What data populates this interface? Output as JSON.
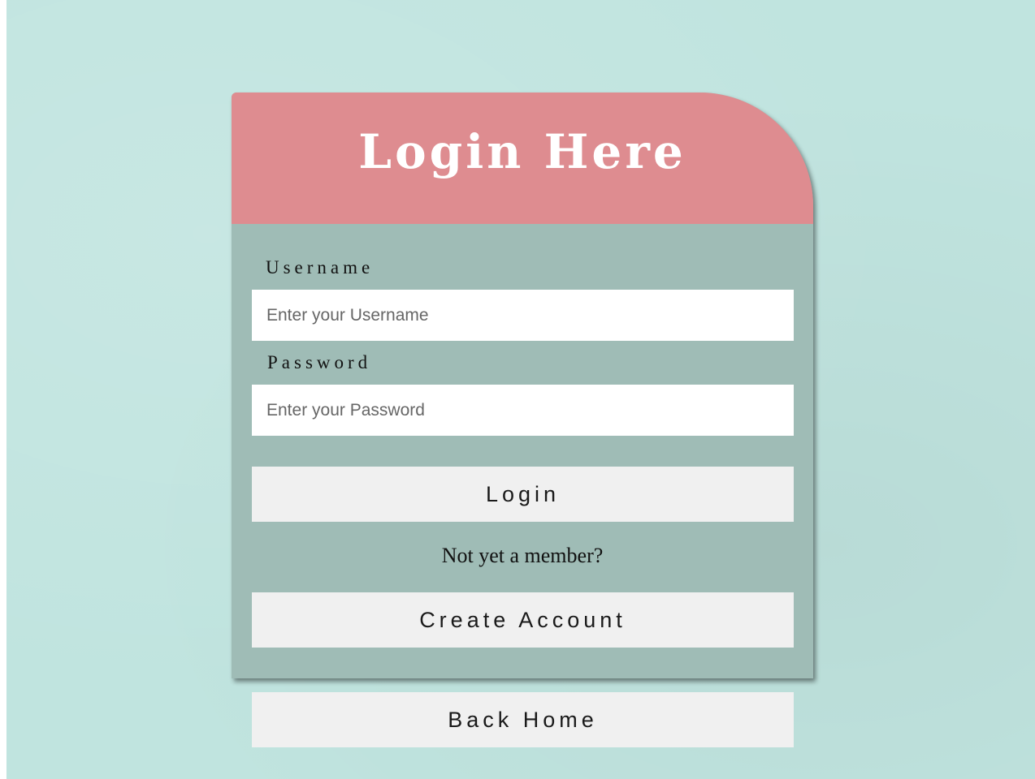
{
  "login_card": {
    "title": "Login Here",
    "username": {
      "label": "Username",
      "placeholder": "Enter your Username",
      "value": ""
    },
    "password": {
      "label": "Password",
      "placeholder": "Enter your Password",
      "value": ""
    },
    "login_button_label": "Login",
    "member_prompt": "Not yet a member?",
    "create_account_label": "Create Account"
  },
  "back_home_label": "Back Home",
  "colors": {
    "background": "#c0e4df",
    "card_body": "#9fbcb6",
    "card_header": "#de8c90",
    "button_bg": "#f0f0f0"
  }
}
